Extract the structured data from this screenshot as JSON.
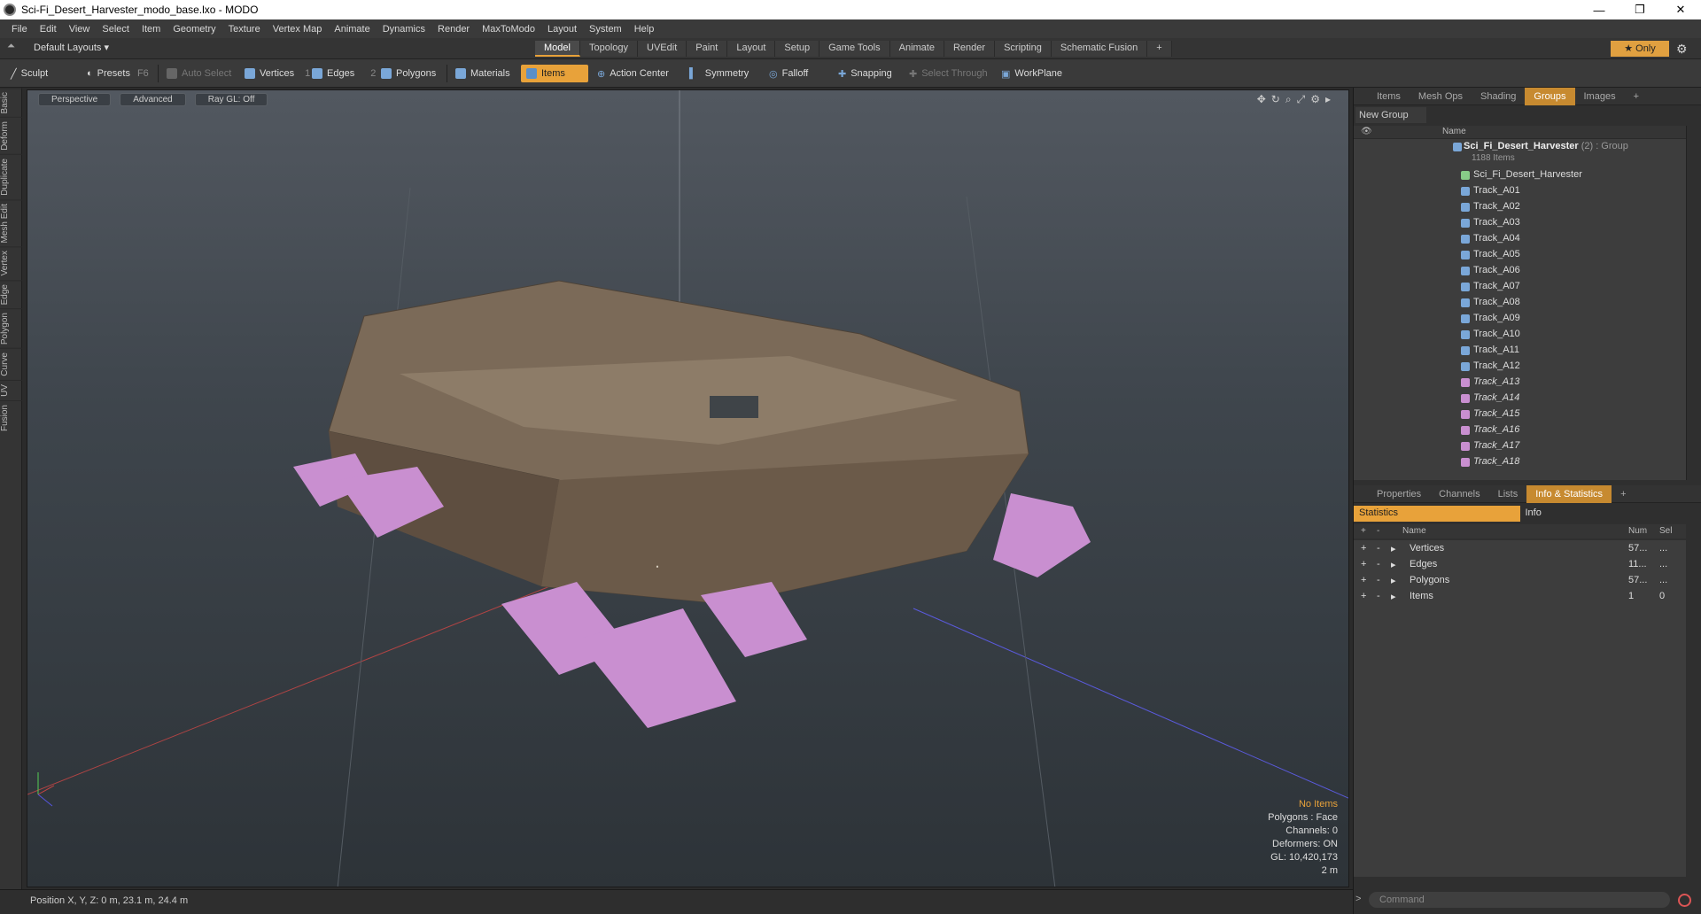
{
  "window": {
    "title": "Sci-Fi_Desert_Harvester_modo_base.lxo - MODO",
    "minimize": "—",
    "maximize": "❐",
    "close": "✕"
  },
  "menu": [
    "File",
    "Edit",
    "View",
    "Select",
    "Item",
    "Geometry",
    "Texture",
    "Vertex Map",
    "Animate",
    "Dynamics",
    "Render",
    "MaxToModo",
    "Layout",
    "System",
    "Help"
  ],
  "layout": {
    "dropdown": "Default Layouts ▾",
    "tabs": [
      "Model",
      "Topology",
      "UVEdit",
      "Paint",
      "Layout",
      "Setup",
      "Game Tools",
      "Animate",
      "Render",
      "Scripting",
      "Schematic Fusion"
    ],
    "active": "Model",
    "only": "★  Only"
  },
  "toolbar": {
    "sculpt": "Sculpt",
    "presets": "Presets",
    "presets_key": "F6",
    "auto_select": "Auto Select",
    "vertices": "Vertices",
    "vertices_n": "1",
    "edges": "Edges",
    "edges_n": "2",
    "polygons": "Polygons",
    "materials": "Materials",
    "items": "Items",
    "action_center": "Action Center",
    "symmetry": "Symmetry",
    "falloff": "Falloff",
    "snapping": "Snapping",
    "select_through": "Select Through",
    "workplane": "WorkPlane"
  },
  "left_tabs": [
    "Basic",
    "Deform",
    "Duplicate",
    "Mesh Edit",
    "Vertex",
    "Edge",
    "Polygon",
    "Curve",
    "UV",
    "Fusion"
  ],
  "viewport": {
    "perspective": "Perspective",
    "advanced": "Advanced",
    "raygl": "Ray GL: Off",
    "stats": {
      "no_items": "No Items",
      "polygons": "Polygons : Face",
      "channels": "Channels: 0",
      "deformers": "Deformers: ON",
      "gl": "GL: 10,420,173",
      "scale": "2 m"
    }
  },
  "status": {
    "position": "Position X, Y, Z:   0 m, 23.1 m, 24.4 m"
  },
  "panel_top": {
    "tabs": [
      "Items",
      "Mesh Ops",
      "Shading",
      "Groups",
      "Images"
    ],
    "active": "Groups",
    "new_group": "New Group",
    "name_col": "Name",
    "group": {
      "name": "Sci_Fi_Desert_Harvester",
      "suffix": " (2) : Group",
      "count": "1188 Items"
    },
    "items": [
      {
        "label": "Sci_Fi_Desert_Harvester",
        "type": "mesh"
      },
      {
        "label": "Track_A01",
        "type": "mesh"
      },
      {
        "label": "Track_A02",
        "type": "mesh"
      },
      {
        "label": "Track_A03",
        "type": "mesh"
      },
      {
        "label": "Track_A04",
        "type": "mesh"
      },
      {
        "label": "Track_A05",
        "type": "mesh"
      },
      {
        "label": "Track_A06",
        "type": "mesh"
      },
      {
        "label": "Track_A07",
        "type": "mesh"
      },
      {
        "label": "Track_A08",
        "type": "mesh"
      },
      {
        "label": "Track_A09",
        "type": "mesh"
      },
      {
        "label": "Track_A10",
        "type": "mesh"
      },
      {
        "label": "Track_A11",
        "type": "mesh"
      },
      {
        "label": "Track_A12",
        "type": "mesh"
      },
      {
        "label": "Track_A13",
        "type": "instance"
      },
      {
        "label": "Track_A14",
        "type": "instance"
      },
      {
        "label": "Track_A15",
        "type": "instance"
      },
      {
        "label": "Track_A16",
        "type": "instance"
      },
      {
        "label": "Track_A17",
        "type": "instance"
      },
      {
        "label": "Track_A18",
        "type": "instance"
      }
    ]
  },
  "panel_bottom": {
    "tabs": [
      "Properties",
      "Channels",
      "Lists",
      "Info & Statistics"
    ],
    "active": "Info & Statistics",
    "subtabs": [
      "Statistics",
      "Info"
    ],
    "cols": {
      "name": "Name",
      "num": "Num",
      "sel": "Sel"
    },
    "rows": [
      {
        "name": "Vertices",
        "num": "57...",
        "sel": "..."
      },
      {
        "name": "Edges",
        "num": "11...",
        "sel": "..."
      },
      {
        "name": "Polygons",
        "num": "57...",
        "sel": "..."
      },
      {
        "name": "Items",
        "num": "1",
        "sel": "0"
      }
    ]
  },
  "command": {
    "placeholder": "Command"
  },
  "colors": {
    "accent": "#e8a23a",
    "selection": "#c98fd0"
  }
}
